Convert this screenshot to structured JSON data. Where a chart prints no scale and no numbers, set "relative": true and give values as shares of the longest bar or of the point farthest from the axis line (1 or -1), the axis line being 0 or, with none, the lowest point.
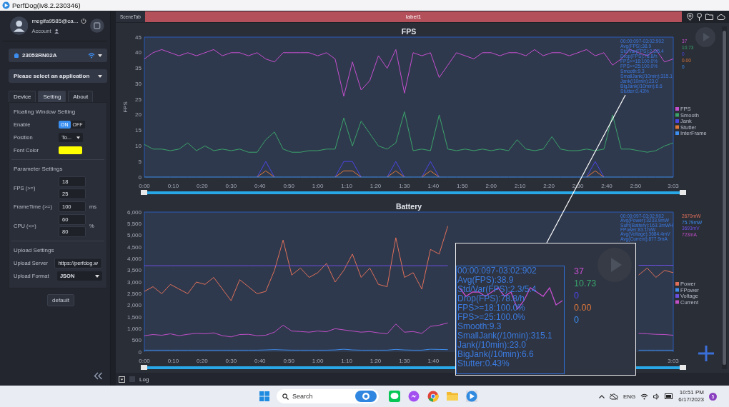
{
  "window": {
    "title": "PerfDog(iv8.2.230346)"
  },
  "sidebar": {
    "account": {
      "name": "megifa9585@ca...",
      "label": "Account"
    },
    "device": {
      "name": "23053RN02A"
    },
    "app_select": {
      "placeholder": "Please select an application"
    },
    "tabs": [
      {
        "label": "Device",
        "selected": false
      },
      {
        "label": "Setting",
        "selected": true
      },
      {
        "label": "About",
        "selected": false
      }
    ],
    "floating_window": {
      "title": "Floating Window Setting",
      "enable": {
        "label": "Enable",
        "on_label": "ON",
        "off_label": "OFF",
        "on": true
      },
      "position": {
        "label": "Position",
        "value": "To..."
      },
      "font_color": {
        "label": "Font Color",
        "color": "#ffff00"
      }
    },
    "parameters": {
      "title": "Parameter Settings",
      "rows": [
        {
          "label": "FPS (>=)",
          "values": [
            "18",
            "25"
          ]
        },
        {
          "label": "FrameTime (>=)",
          "values": [
            "100"
          ],
          "unit": "ms"
        },
        {
          "label": "CPU (<=)",
          "values": [
            "60",
            "80"
          ],
          "unit": "%"
        }
      ]
    },
    "upload": {
      "title": "Upload Settings",
      "server": {
        "label": "Upload Server",
        "value": "https://perfdog.w"
      },
      "format": {
        "label": "Upload Format",
        "value": "JSON"
      }
    },
    "default_button": "default"
  },
  "scene_tabs": {
    "tab": "SceneTab",
    "label": "label1"
  },
  "fps_panel": {
    "chart_data": {
      "type": "line",
      "title": "FPS",
      "ylabel": "FPS",
      "xlim": [
        0,
        183
      ],
      "ylim": [
        0,
        45
      ],
      "x": [
        0,
        3,
        6,
        9,
        12,
        15,
        18,
        21,
        24,
        27,
        30,
        33,
        36,
        39,
        42,
        45,
        48,
        51,
        54,
        57,
        60,
        63,
        66,
        69,
        72,
        75,
        78,
        81,
        84,
        87,
        90,
        93,
        96,
        99,
        102,
        105,
        108,
        111,
        114,
        117,
        120,
        123,
        126,
        129,
        132,
        135,
        138,
        141,
        144,
        147,
        150,
        153,
        156,
        159,
        162,
        165,
        168,
        171,
        174,
        177,
        180,
        183
      ],
      "xticks": [
        {
          "value": 0,
          "label": "0:00"
        },
        {
          "value": 10,
          "label": "0:10"
        },
        {
          "value": 20,
          "label": "0:20"
        },
        {
          "value": 30,
          "label": "0:30"
        },
        {
          "value": 40,
          "label": "0:40"
        },
        {
          "value": 50,
          "label": "0:50"
        },
        {
          "value": 60,
          "label": "1:00"
        },
        {
          "value": 70,
          "label": "1:10"
        },
        {
          "value": 80,
          "label": "1:20"
        },
        {
          "value": 90,
          "label": "1:30"
        },
        {
          "value": 100,
          "label": "1:40"
        },
        {
          "value": 110,
          "label": "1:50"
        },
        {
          "value": 120,
          "label": "2:00"
        },
        {
          "value": 130,
          "label": "2:10"
        },
        {
          "value": 140,
          "label": "2:20"
        },
        {
          "value": 150,
          "label": "2:30"
        },
        {
          "value": 160,
          "label": "2:40"
        },
        {
          "value": 170,
          "label": "2:50"
        },
        {
          "value": 183,
          "label": "3:03"
        }
      ],
      "yticks": [
        0,
        5,
        10,
        15,
        20,
        25,
        30,
        35,
        40,
        45
      ],
      "series": [
        {
          "name": "FPS",
          "color": "#c64fd0",
          "values": [
            38,
            40,
            41,
            40,
            39,
            40,
            39,
            40,
            41,
            39,
            40,
            40,
            39,
            40,
            38,
            37,
            40,
            40,
            40,
            40,
            39,
            40,
            38,
            26,
            37,
            28,
            31,
            39,
            35,
            41,
            27,
            40,
            39,
            40,
            32,
            36,
            40,
            39,
            38,
            40,
            40,
            39,
            40,
            40,
            39,
            41,
            39,
            40,
            40,
            39,
            40,
            41,
            39,
            40,
            36,
            38,
            41,
            40,
            39,
            41,
            37,
            38
          ]
        },
        {
          "name": "Smooth",
          "color": "#3aa36b",
          "values": [
            10.5,
            9,
            9,
            8.5,
            9,
            11,
            8.5,
            10,
            8.5,
            9,
            8.5,
            9,
            8,
            8,
            12,
            14.5,
            9,
            8,
            8,
            8.5,
            8.5,
            9,
            9,
            19,
            10,
            18,
            14,
            10,
            9,
            11,
            21,
            8.5,
            9,
            8.5,
            20,
            9,
            8.5,
            9,
            8.5,
            9,
            8.5,
            9,
            8.5,
            12,
            9,
            8.5,
            9,
            13,
            9,
            8.5,
            8.5,
            9,
            8.5,
            9,
            20,
            9,
            9,
            8.5,
            8,
            8.5,
            10,
            11
          ]
        },
        {
          "name": "Jank",
          "color": "#4a46e6",
          "values": [
            null,
            null,
            null,
            null,
            null,
            null,
            null,
            null,
            null,
            null,
            null,
            null,
            null,
            0,
            5,
            0,
            null,
            null,
            null,
            null,
            null,
            null,
            0,
            5,
            5,
            0,
            null,
            null,
            0,
            5,
            0,
            null,
            0,
            5,
            0,
            null,
            null,
            null,
            null,
            null,
            null,
            null,
            null,
            null,
            null,
            null,
            null,
            null,
            null,
            null,
            null,
            0,
            5,
            0,
            null,
            null,
            null,
            null,
            null,
            null,
            null,
            null
          ]
        },
        {
          "name": "Stutter",
          "color": "#e0783a",
          "values": [
            null,
            null,
            null,
            null,
            null,
            null,
            null,
            null,
            null,
            null,
            null,
            null,
            null,
            0,
            2,
            0,
            null,
            null,
            null,
            null,
            null,
            null,
            0,
            2,
            2,
            0,
            null,
            null,
            0,
            2,
            0,
            null,
            0,
            2,
            0,
            null,
            null,
            null,
            null,
            null,
            null,
            null,
            null,
            null,
            null,
            null,
            null,
            null,
            null,
            null,
            null,
            0,
            2,
            0,
            null,
            null,
            null,
            null,
            null,
            null,
            null,
            null
          ]
        },
        {
          "name": "InterFrame",
          "color": "#3d8ef0",
          "values": [
            0,
            0,
            0,
            0,
            0,
            0,
            0,
            0,
            0,
            0,
            0,
            0,
            0,
            0,
            0,
            0,
            0,
            0,
            0,
            0,
            0,
            0,
            0,
            0,
            0,
            0,
            0,
            0,
            0,
            0,
            0,
            0,
            0,
            0,
            0,
            0,
            0,
            0,
            0,
            0,
            0,
            0,
            0,
            0,
            0,
            0,
            0,
            0,
            0,
            0,
            0,
            0,
            0,
            0,
            0,
            0,
            0,
            0,
            0,
            0,
            0,
            0
          ]
        }
      ],
      "legend": true
    },
    "stats": [
      "00:00:097-03:02:902",
      "Avg(FPS):38.9",
      "Std/Var(FPS):2.3/5.4",
      "Drop(FPS):78.8/h",
      "FPS>=18:100.0%",
      "FPS>=25:100.0%",
      "Smooth:9.3",
      "SmallJank(/10min):315.1",
      "Jank(/10min):23.0",
      "BigJank(/10min):6.6",
      "Stutter:0.43%"
    ],
    "current_values": [
      "37",
      "10.73",
      "0",
      "0.00",
      "0"
    ]
  },
  "battery_panel": {
    "chart_data": {
      "type": "line",
      "title": "Battery",
      "xlim": [
        0,
        183
      ],
      "ylim": [
        0,
        6000
      ],
      "x": [
        0,
        3,
        6,
        9,
        12,
        15,
        18,
        21,
        24,
        27,
        30,
        33,
        36,
        39,
        42,
        45,
        48,
        51,
        54,
        57,
        60,
        63,
        66,
        69,
        72,
        75,
        78,
        81,
        84,
        87,
        90,
        93,
        96,
        99,
        102,
        105,
        108,
        111,
        114,
        117,
        120,
        123,
        126,
        129,
        132,
        135,
        138,
        141,
        144,
        147,
        150,
        153,
        156,
        159,
        162,
        165,
        168,
        171,
        174,
        177,
        180,
        183
      ],
      "xticks": [
        {
          "value": 0,
          "label": "0:00"
        },
        {
          "value": 10,
          "label": "0:10"
        },
        {
          "value": 20,
          "label": "0:20"
        },
        {
          "value": 30,
          "label": "0:30"
        },
        {
          "value": 40,
          "label": "0:40"
        },
        {
          "value": 50,
          "label": "0:50"
        },
        {
          "value": 60,
          "label": "1:00"
        },
        {
          "value": 70,
          "label": "1:10"
        },
        {
          "value": 80,
          "label": "1:20"
        },
        {
          "value": 90,
          "label": "1:30"
        },
        {
          "value": 100,
          "label": "1:40"
        },
        {
          "value": 183,
          "label": "3:03"
        }
      ],
      "yticks": [
        {
          "value": 0,
          "label": "0"
        },
        {
          "value": 500,
          "label": "500"
        },
        {
          "value": 1000,
          "label": "1,000"
        },
        {
          "value": 1500,
          "label": "1,500"
        },
        {
          "value": 2000,
          "label": "2,000"
        },
        {
          "value": 2500,
          "label": "2,500"
        },
        {
          "value": 3000,
          "label": "3,000"
        },
        {
          "value": 3500,
          "label": "3,500"
        },
        {
          "value": 4000,
          "label": "4,000"
        },
        {
          "value": 4500,
          "label": "4,500"
        },
        {
          "value": 5000,
          "label": "5,000"
        },
        {
          "value": 5500,
          "label": "5,500"
        },
        {
          "value": 6000,
          "label": "6,000"
        }
      ],
      "series": [
        {
          "name": "Power",
          "color": "#e0705a",
          "values": [
            2600,
            2800,
            2500,
            2900,
            2700,
            2500,
            3000,
            2900,
            3200,
            2700,
            2200,
            3100,
            2800,
            2500,
            2600,
            3500,
            4800,
            3300,
            3600,
            3200,
            3400,
            3800,
            3000,
            3500,
            4200,
            3200,
            3600,
            2900,
            2800,
            4900,
            3200,
            3400,
            2700,
            4400,
            4200,
            5400,
            null,
            null,
            null,
            null,
            null,
            null,
            null,
            null,
            null,
            null,
            null,
            null,
            null,
            null,
            null,
            null,
            null,
            null,
            null,
            null,
            null,
            3300,
            3600,
            3200,
            3500,
            3400
          ]
        },
        {
          "name": "FPower",
          "color": "#3d8ef0",
          "values": [
            80,
            80,
            80,
            80,
            80,
            80,
            80,
            80,
            80,
            80,
            80,
            80,
            80,
            80,
            90,
            100,
            90,
            80,
            80,
            80,
            80,
            80,
            90,
            120,
            90,
            80,
            80,
            80,
            80,
            110,
            90,
            80,
            80,
            120,
            110,
            100,
            null,
            null,
            null,
            null,
            null,
            null,
            null,
            null,
            null,
            null,
            null,
            null,
            null,
            null,
            null,
            null,
            null,
            null,
            null,
            null,
            null,
            80,
            80,
            80,
            80,
            80
          ]
        },
        {
          "name": "Voltage",
          "color": "#6a4fe0",
          "values": [
            3700,
            3700,
            3700,
            3700,
            3700,
            3700,
            3700,
            3700,
            3700,
            3700,
            3700,
            3700,
            3700,
            3700,
            3700,
            3700,
            3700,
            3700,
            3700,
            3700,
            3700,
            3700,
            3700,
            3700,
            3700,
            3700,
            3700,
            3700,
            3700,
            3700,
            3700,
            3700,
            3700,
            3700,
            3700,
            3700,
            null,
            null,
            null,
            null,
            null,
            null,
            null,
            null,
            null,
            null,
            null,
            null,
            null,
            null,
            null,
            null,
            null,
            null,
            null,
            null,
            null,
            3720,
            3720,
            3720,
            3720,
            3720
          ]
        },
        {
          "name": "Current",
          "color": "#c04fc8",
          "values": [
            700,
            750,
            720,
            780,
            700,
            760,
            800,
            780,
            820,
            700,
            650,
            750,
            760,
            700,
            720,
            850,
            1150,
            900,
            880,
            850,
            900,
            870,
            1000,
            950,
            900,
            850,
            880,
            820,
            780,
            1200,
            850,
            880,
            800,
            1100,
            1150,
            1250,
            null,
            null,
            null,
            null,
            null,
            null,
            null,
            null,
            null,
            null,
            null,
            null,
            null,
            null,
            null,
            null,
            null,
            null,
            null,
            null,
            null,
            800,
            780,
            760,
            750,
            720
          ]
        }
      ],
      "legend": true
    },
    "stats": [
      "00:00:097-03:02:902",
      "Avg(Power):3233.9mW",
      "Sum(Battery):163.3mWH",
      "FPower:83.1mW",
      "Avg(Voltage):3684.4mV",
      "Avg(Current):877.9mA"
    ],
    "current_values": [
      "2670mW",
      "75.79mW",
      "3693mV",
      "723mA"
    ]
  },
  "magnifier": {
    "chart_data": {
      "type": "line",
      "relative": true,
      "series": [
        {
          "color": "#c64fd0",
          "values": [
            1,
            0.6,
            0.8,
            0.8,
            0.6,
            0.8,
            1,
            0.6,
            0.8,
            0,
            0.4,
            1,
            0.8,
            0.6,
            1,
            0.2,
            0.4
          ]
        }
      ]
    },
    "stats": [
      "00:00:097-03:02:902",
      "Avg(FPS):38.9",
      "Std/Var(FPS):2.3/5.4",
      "Drop(FPS):78.8/h",
      "FPS>=18:100.0%",
      "FPS>=25:100.0%",
      "Smooth:9.3",
      "SmallJank(/10min):315.1",
      "Jank(/10min):23.0",
      "BigJank(/10min):6.6",
      "Stutter:0.43%"
    ],
    "current_values": [
      "37",
      "10.73",
      "0",
      "0.00",
      "0"
    ]
  },
  "log": {
    "label": "Log",
    "checked": false
  },
  "taskbar": {
    "search": {
      "placeholder": "Search"
    },
    "language": "ENG",
    "time": "10:51 PM",
    "date": "6/17/2023",
    "notifications": "5"
  }
}
